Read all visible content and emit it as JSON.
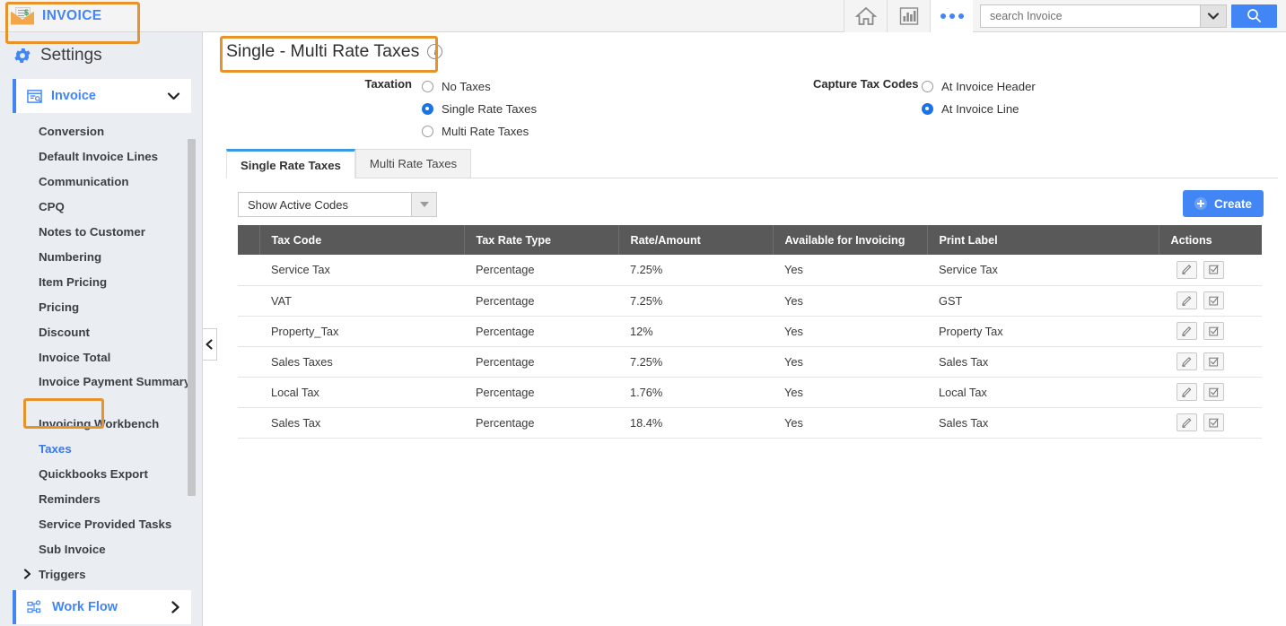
{
  "topbar": {
    "brand": "INVOICE",
    "icons": [
      "home-icon",
      "chart-icon",
      "more-icon"
    ],
    "search": {
      "value": "",
      "placeholder": "search Invoice"
    }
  },
  "sidebar": {
    "title": "Settings",
    "group": {
      "label": "Invoice",
      "expanded": true
    },
    "items": [
      {
        "label": "Conversion",
        "active": false
      },
      {
        "label": "Default Invoice Lines",
        "active": false
      },
      {
        "label": "Communication",
        "active": false
      },
      {
        "label": "CPQ",
        "active": false
      },
      {
        "label": "Notes to Customer",
        "active": false
      },
      {
        "label": "Numbering",
        "active": false
      },
      {
        "label": "Item Pricing",
        "active": false
      },
      {
        "label": "Pricing",
        "active": false
      },
      {
        "label": "Discount",
        "active": false
      },
      {
        "label": "Invoice Total",
        "active": false
      },
      {
        "label": "Invoice Payment Summary",
        "active": false
      },
      {
        "label": "Invoicing Workbench",
        "active": false
      },
      {
        "label": "Taxes",
        "active": true
      },
      {
        "label": "Quickbooks Export",
        "active": false
      },
      {
        "label": "Reminders",
        "active": false
      },
      {
        "label": "Service Provided Tasks",
        "active": false
      },
      {
        "label": "Sub Invoice",
        "active": false
      },
      {
        "label": "Triggers",
        "active": false
      }
    ],
    "bottom_group": {
      "label": "Work Flow"
    }
  },
  "main": {
    "title": "Single - Multi Rate Taxes",
    "taxation": {
      "label": "Taxation",
      "options": [
        {
          "label": "No Taxes",
          "selected": false
        },
        {
          "label": "Single Rate Taxes",
          "selected": true
        },
        {
          "label": "Multi Rate Taxes",
          "selected": false
        }
      ]
    },
    "capture_tax_codes": {
      "label": "Capture Tax Codes",
      "options": [
        {
          "label": "At Invoice Header",
          "selected": false
        },
        {
          "label": "At Invoice Line",
          "selected": true
        }
      ]
    },
    "tabs": [
      {
        "label": "Single Rate Taxes",
        "active": true
      },
      {
        "label": "Multi Rate Taxes",
        "active": false
      }
    ],
    "filter": {
      "value": "Show Active Codes"
    },
    "create_button": "Create",
    "table": {
      "columns": [
        "Tax Code",
        "Tax Rate Type",
        "Rate/Amount",
        "Available for Invoicing",
        "Print Label",
        "Actions"
      ],
      "rows": [
        {
          "tax_code": "Service Tax",
          "tax_rate_type": "Percentage",
          "rate_amount": "7.25%",
          "available": "Yes",
          "print_label": "Service Tax"
        },
        {
          "tax_code": "VAT",
          "tax_rate_type": "Percentage",
          "rate_amount": "7.25%",
          "available": "Yes",
          "print_label": "GST"
        },
        {
          "tax_code": "Property_Tax",
          "tax_rate_type": "Percentage",
          "rate_amount": "12%",
          "available": "Yes",
          "print_label": "Property Tax"
        },
        {
          "tax_code": "Sales Taxes",
          "tax_rate_type": "Percentage",
          "rate_amount": "7.25%",
          "available": "Yes",
          "print_label": "Sales Tax"
        },
        {
          "tax_code": "Local Tax",
          "tax_rate_type": "Percentage",
          "rate_amount": "1.76%",
          "available": "Yes",
          "print_label": "Local Tax"
        },
        {
          "tax_code": "Sales Tax",
          "tax_rate_type": "Percentage",
          "rate_amount": "18.4%",
          "available": "Yes",
          "print_label": "Sales Tax"
        }
      ]
    }
  },
  "colors": {
    "brand_blue": "#4285f4",
    "highlight_orange": "#e8932a",
    "table_header_gray": "#595959",
    "sidebar_bg": "#eaeef3",
    "tab_accent": "#3b9ae1"
  }
}
